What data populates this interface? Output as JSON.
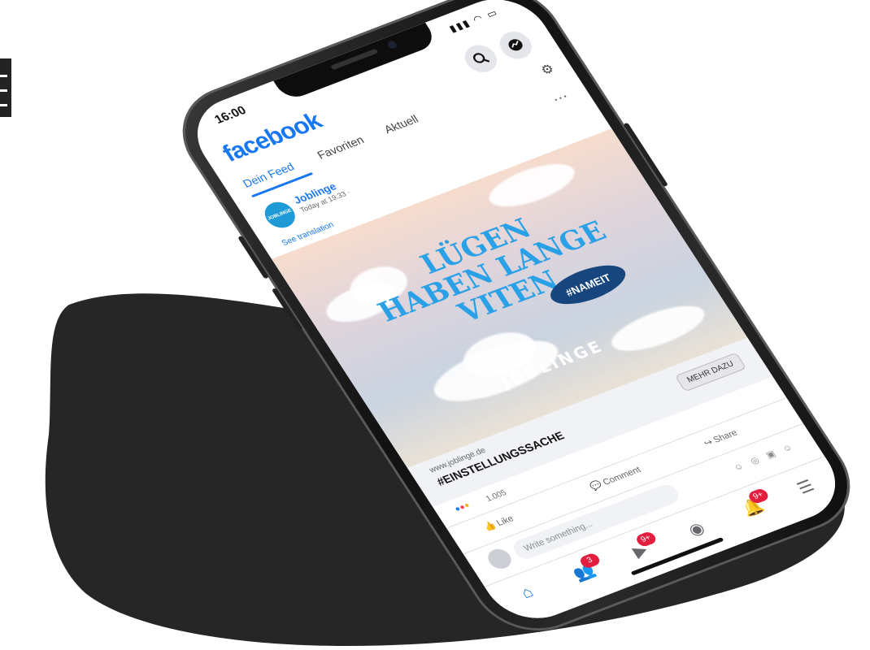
{
  "status": {
    "time": "16:00"
  },
  "app": {
    "logo": "facebook"
  },
  "tabs": [
    {
      "label": "Dein Feed",
      "active": true
    },
    {
      "label": "Favoriten",
      "active": false
    },
    {
      "label": "Aktuell",
      "active": false
    }
  ],
  "post": {
    "author": "Joblinge",
    "meta": "Today at 19:33 · ",
    "avatar_text": "JOBLINGE",
    "see_translation": "See translation",
    "image": {
      "headline_lines": [
        "LÜGEN",
        "HABEN LANGE",
        "VITEN"
      ],
      "badge": "#NAMEIT",
      "brand": "JOBLINGE"
    },
    "link": {
      "url": "www.joblinge.de",
      "title": "#EINSTELLUNGSSACHE",
      "cta": "MEHR DAZU"
    },
    "reactions_count": "1.005",
    "actions": {
      "like": "Like",
      "comment": "Comment",
      "share": "Share"
    },
    "comment_placeholder": "Write something..."
  },
  "bottom_nav": {
    "friends_badge": "3",
    "video_badge": "9+",
    "notifications_badge": "9+"
  },
  "colors": {
    "brand": "#1877f2",
    "badge_red": "#e41e3f",
    "headline": "#2aa1e6",
    "nameit_badge": "#16467d"
  }
}
